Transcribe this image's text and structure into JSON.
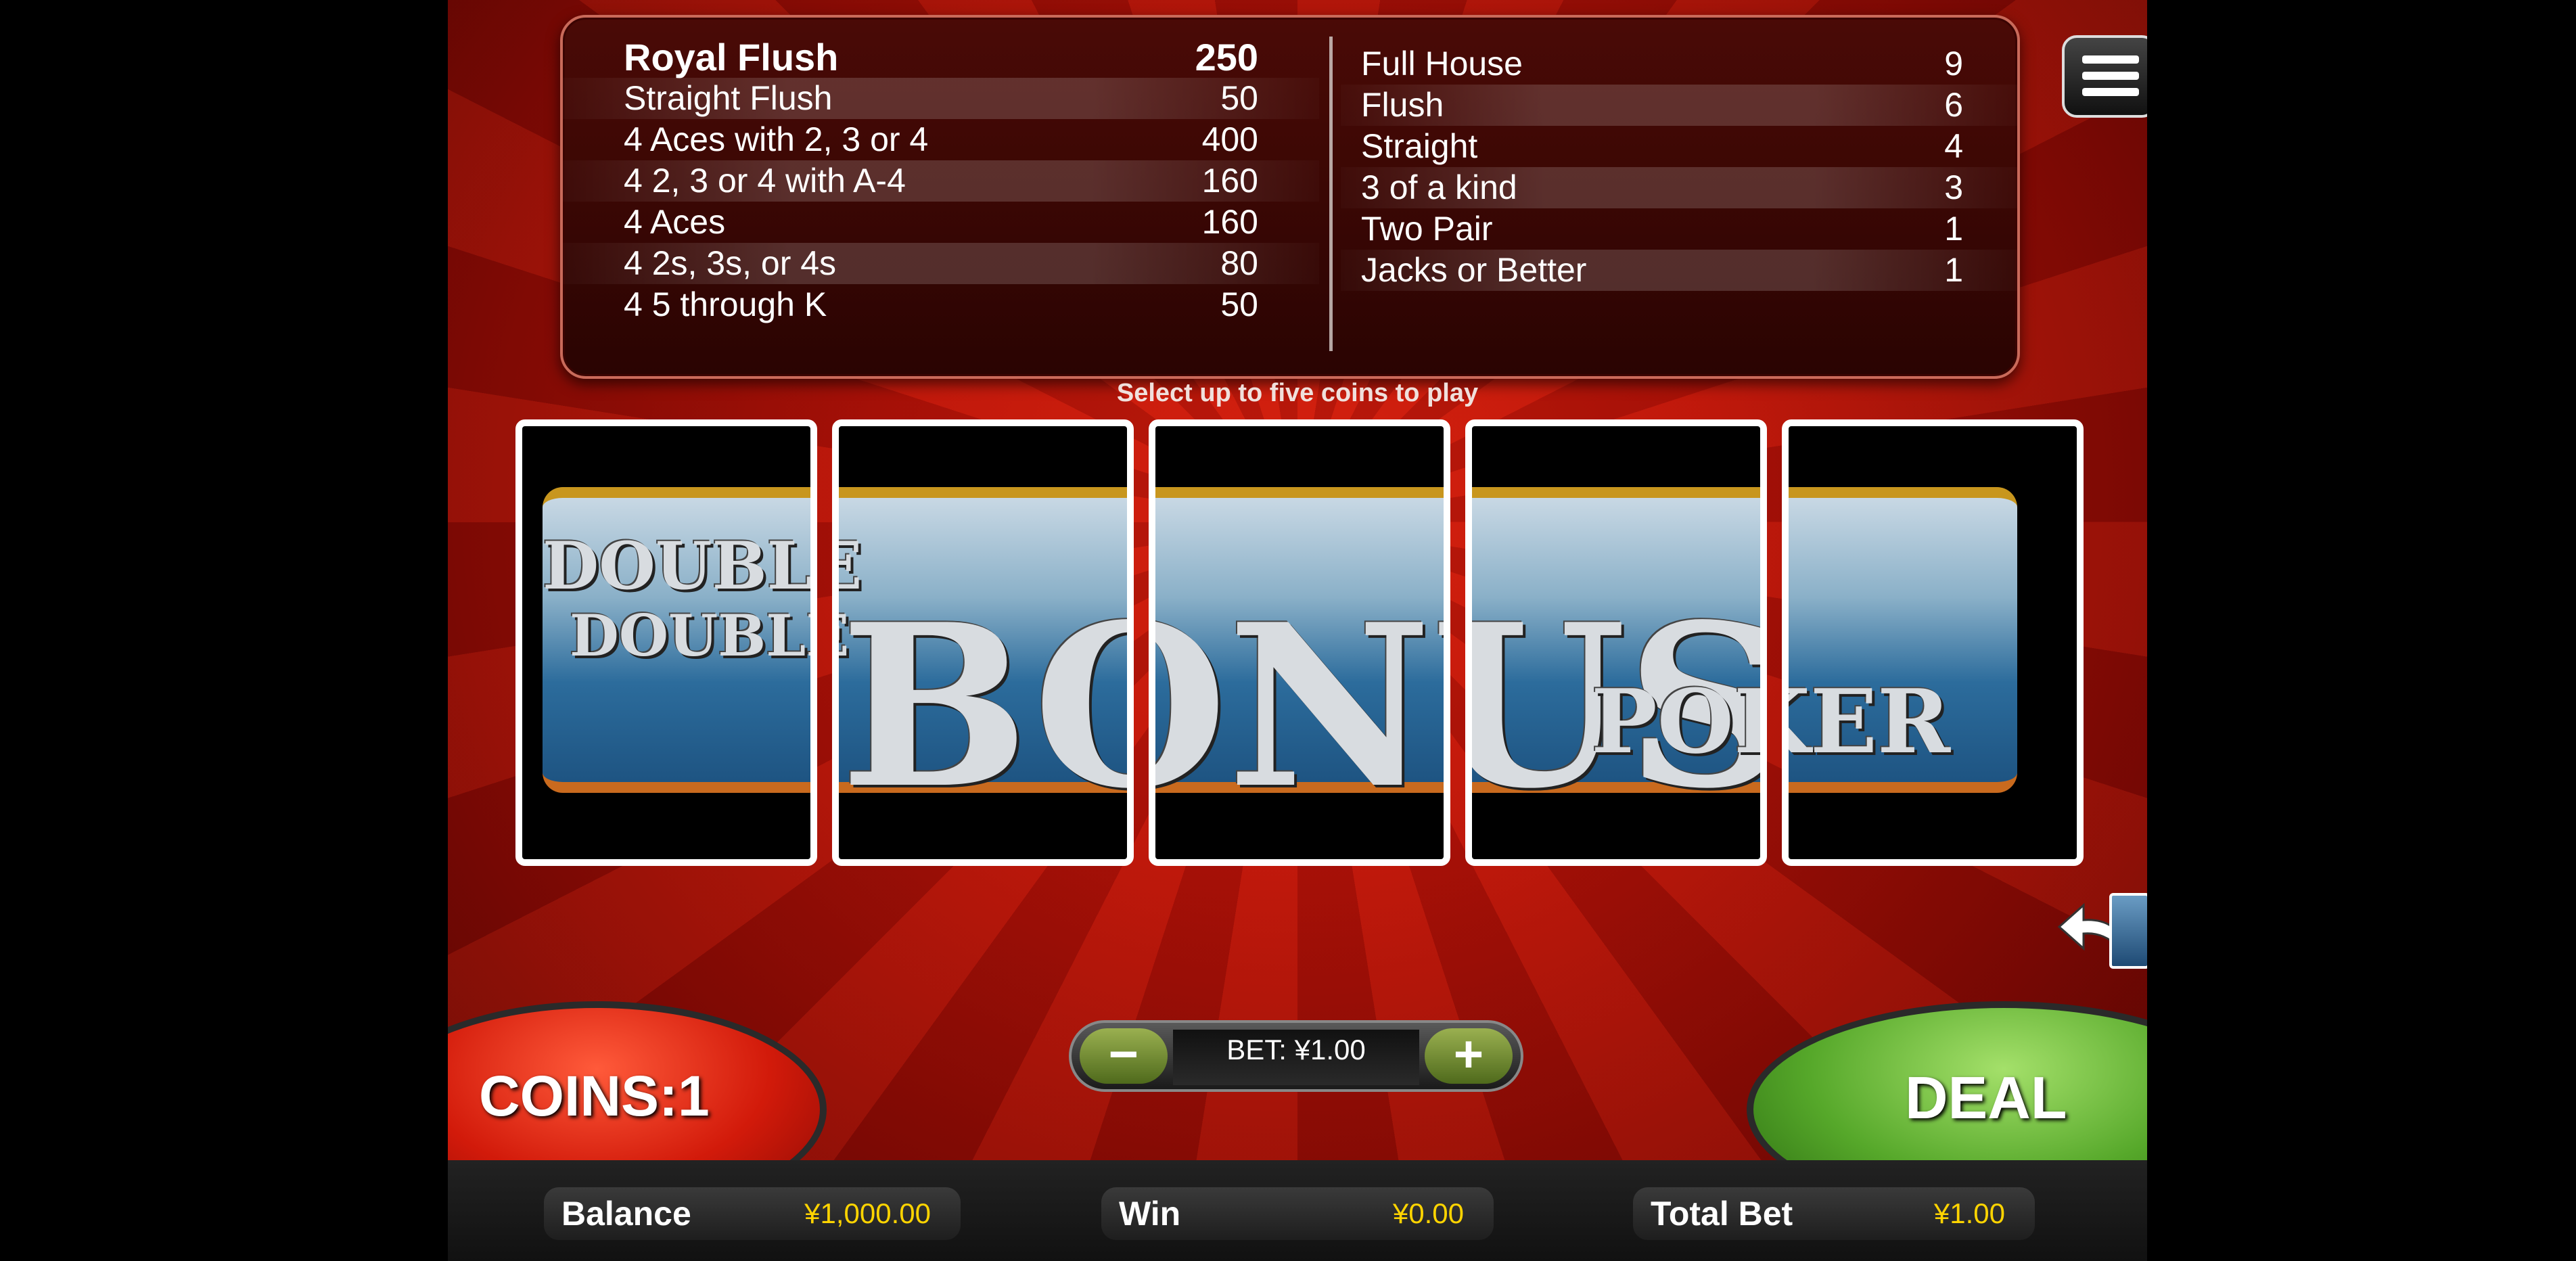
{
  "paytable": {
    "left": [
      {
        "name": "Royal Flush",
        "pay": "250"
      },
      {
        "name": "Straight Flush",
        "pay": "50"
      },
      {
        "name": "4 Aces with 2, 3 or 4",
        "pay": "400"
      },
      {
        "name": "4 2, 3 or 4 with A-4",
        "pay": "160"
      },
      {
        "name": "4 Aces",
        "pay": "160"
      },
      {
        "name": "4 2s, 3s, or 4s",
        "pay": "80"
      },
      {
        "name": "4 5 through K",
        "pay": "50"
      }
    ],
    "right": [
      {
        "name": "Full House",
        "pay": "9"
      },
      {
        "name": "Flush",
        "pay": "6"
      },
      {
        "name": "Straight",
        "pay": "4"
      },
      {
        "name": "3 of a kind",
        "pay": "3"
      },
      {
        "name": "Two Pair",
        "pay": "1"
      },
      {
        "name": "Jacks or Better",
        "pay": "1"
      }
    ]
  },
  "prompt": "Select up to five coins to play",
  "banner": {
    "line1": "DOUBLE",
    "line2": "DOUBLE",
    "line3": "BONUS",
    "line4": "POKER"
  },
  "bet": {
    "minus": "−",
    "plus": "+",
    "label": "BET: ¥1.00"
  },
  "coins_label": "COINS:1",
  "deal_label": "DEAL",
  "footer": {
    "balance_label": "Balance",
    "balance_value": "¥1,000.00",
    "win_label": "Win",
    "win_value": "¥0.00",
    "total_bet_label": "Total Bet",
    "total_bet_value": "¥1.00"
  },
  "icons": {
    "menu": "hamburger-menu-icon",
    "undo": "undo-arrow-icon"
  },
  "colors": {
    "deal": "#56a82a",
    "coins": "#d21a0a",
    "value_text": "#ffd400"
  }
}
